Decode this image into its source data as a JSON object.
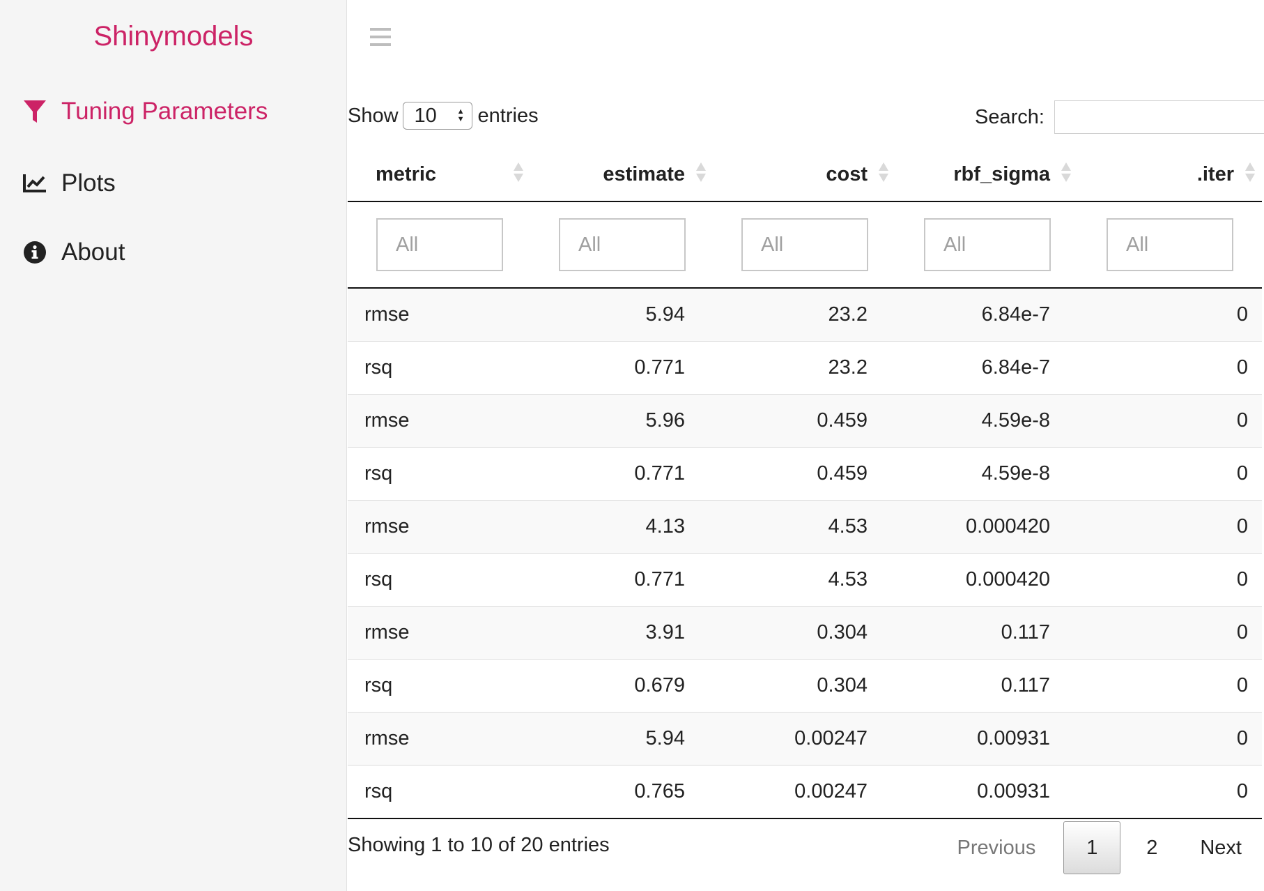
{
  "app": {
    "brand": "Shinymodels"
  },
  "sidebar": {
    "items": [
      {
        "label": "Tuning Parameters",
        "icon": "filter-icon"
      },
      {
        "label": "Plots",
        "icon": "line-chart-icon"
      },
      {
        "label": "About",
        "icon": "info-circle-icon"
      }
    ]
  },
  "colors": {
    "accent": "#cc2366"
  },
  "toolbar": {
    "show_label": "Show",
    "length_value": "10",
    "entries_label": "entries",
    "search_label": "Search:",
    "search_value": ""
  },
  "table": {
    "columns": [
      "metric",
      "estimate",
      "cost",
      "rbf_sigma",
      ".iter"
    ],
    "filter_placeholder": "All",
    "rows": [
      [
        "rmse",
        "5.94",
        "23.2",
        "6.84e-7",
        "0"
      ],
      [
        "rsq",
        "0.771",
        "23.2",
        "6.84e-7",
        "0"
      ],
      [
        "rmse",
        "5.96",
        "0.459",
        "4.59e-8",
        "0"
      ],
      [
        "rsq",
        "0.771",
        "0.459",
        "4.59e-8",
        "0"
      ],
      [
        "rmse",
        "4.13",
        "4.53",
        "0.000420",
        "0"
      ],
      [
        "rsq",
        "0.771",
        "4.53",
        "0.000420",
        "0"
      ],
      [
        "rmse",
        "3.91",
        "0.304",
        "0.117",
        "0"
      ],
      [
        "rsq",
        "0.679",
        "0.304",
        "0.117",
        "0"
      ],
      [
        "rmse",
        "5.94",
        "0.00247",
        "0.00931",
        "0"
      ],
      [
        "rsq",
        "0.765",
        "0.00247",
        "0.00931",
        "0"
      ]
    ]
  },
  "footer": {
    "info": "Showing 1 to 10 of 20 entries",
    "previous": "Previous",
    "pages": [
      "1",
      "2"
    ],
    "current_page": "1",
    "next": "Next"
  }
}
